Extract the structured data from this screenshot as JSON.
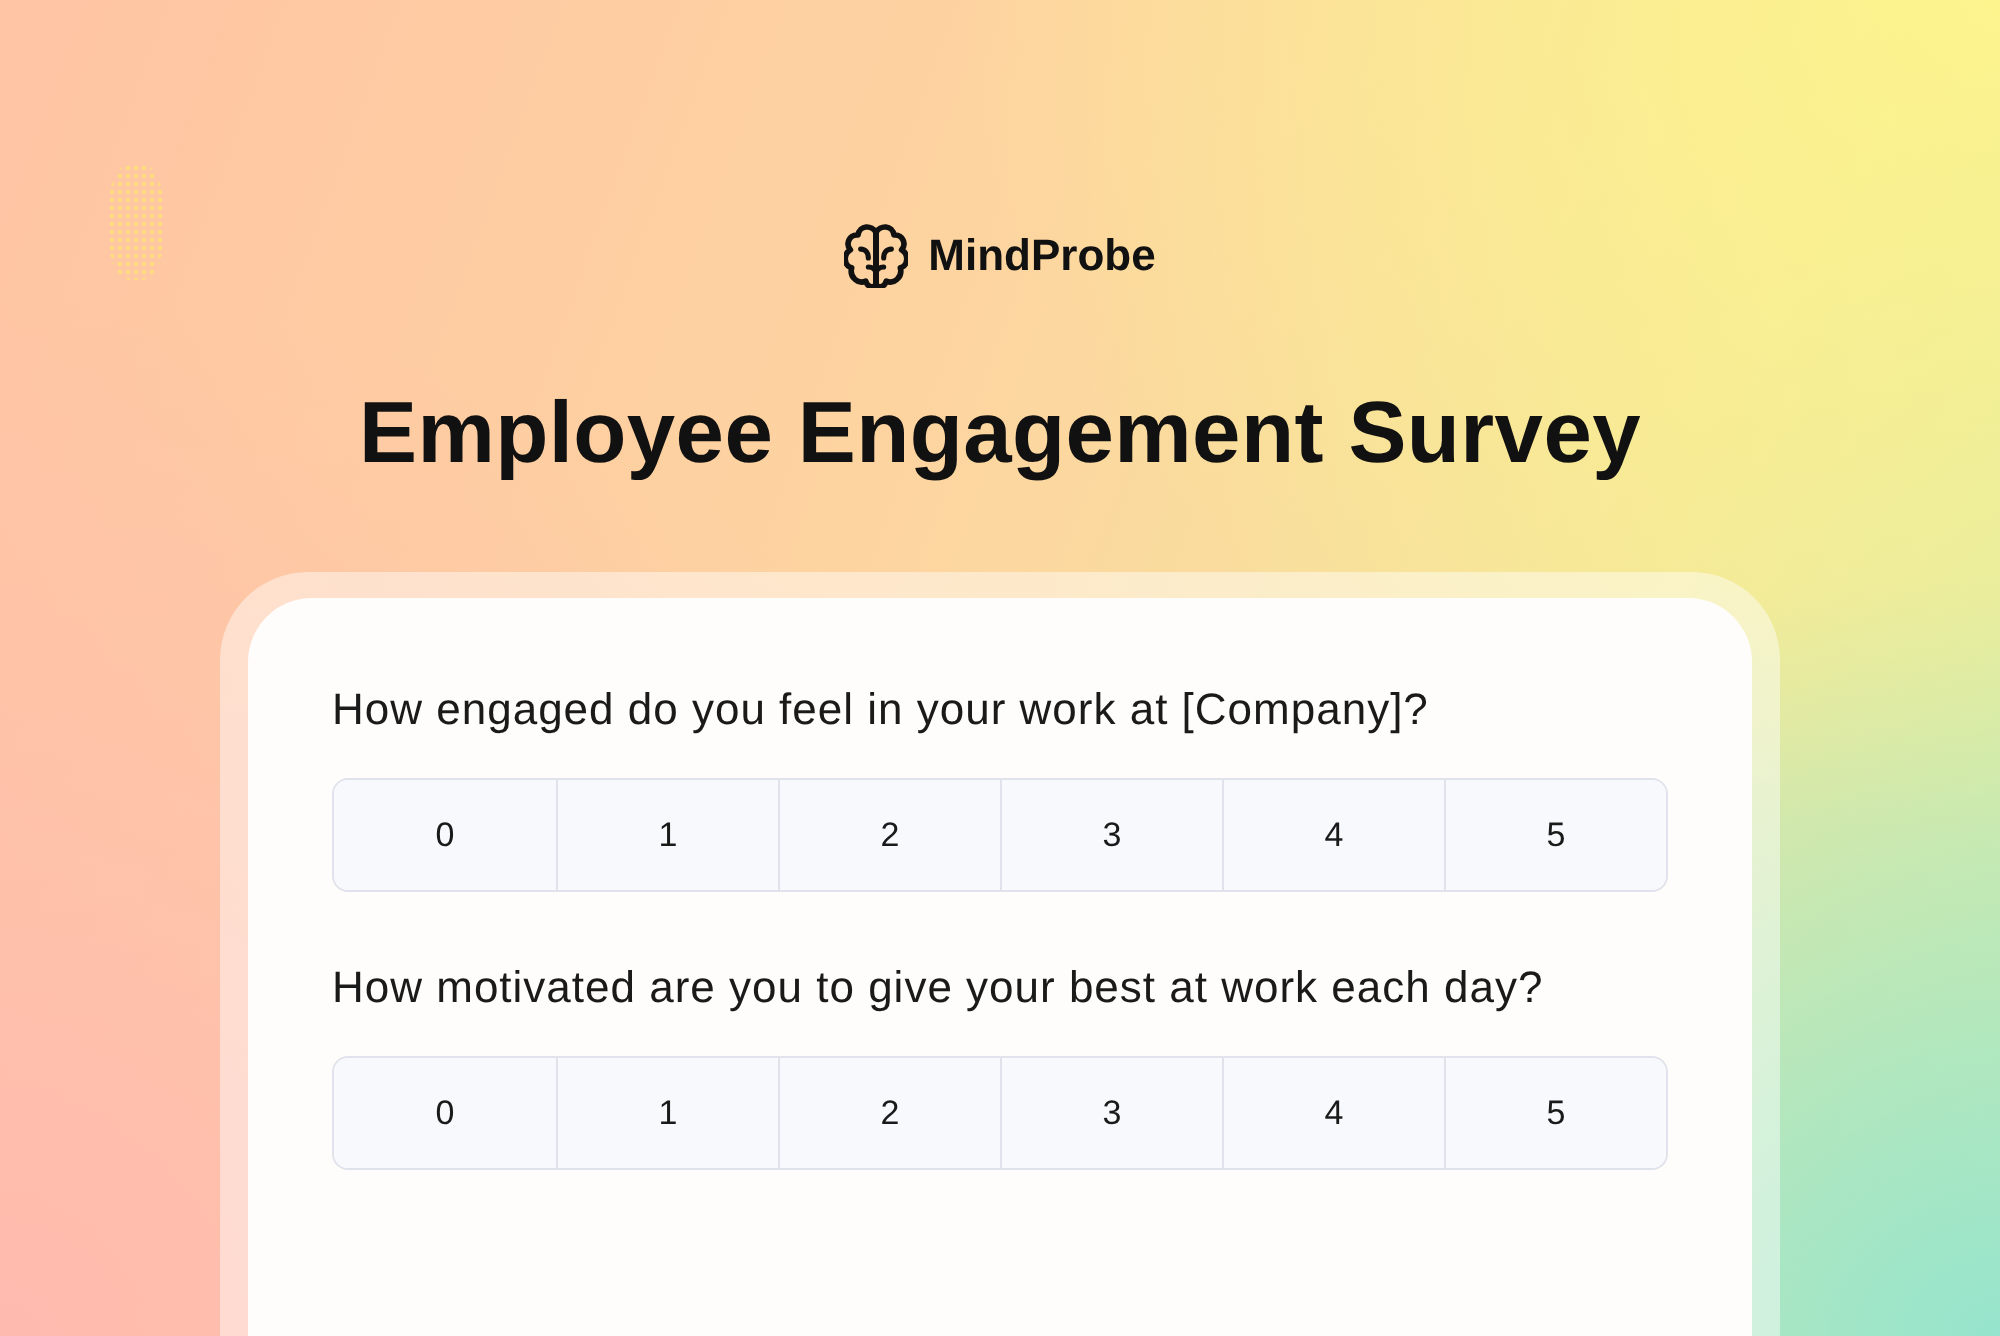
{
  "brand": {
    "name": "MindProbe"
  },
  "title": "Employee Engagement Survey",
  "questions": [
    {
      "text": "How engaged do you feel in your work at [Company]?",
      "options": [
        {
          "label": "0",
          "selected": false
        },
        {
          "label": "1",
          "selected": false
        },
        {
          "label": "2",
          "selected": false
        },
        {
          "label": "3",
          "selected": false
        },
        {
          "label": "4",
          "selected": false
        },
        {
          "label": "5",
          "selected": false
        }
      ]
    },
    {
      "text": "How motivated are you to give your best at work each day?",
      "options": [
        {
          "label": "0",
          "selected": false
        },
        {
          "label": "1",
          "selected": false
        },
        {
          "label": "2",
          "selected": false
        },
        {
          "label": "3",
          "selected": false
        },
        {
          "label": "4",
          "selected": false
        },
        {
          "label": "5",
          "selected": false
        }
      ]
    }
  ]
}
